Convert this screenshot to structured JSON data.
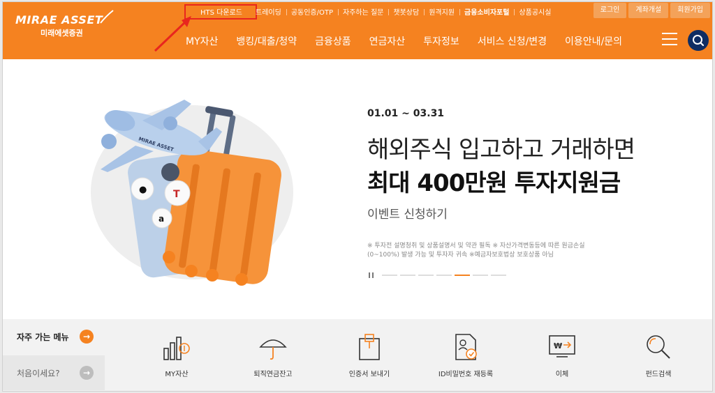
{
  "brand": {
    "name": "MIRAE ASSET",
    "name_kr": "미래에셋증권",
    "accent": "#f58220",
    "navy": "#0f2d63"
  },
  "util_nav": {
    "hts_label": "HTS 다운로드",
    "items": [
      "트레이딩",
      "공동인증/OTP",
      "자주하는 질문",
      "챗봇상담",
      "원격지원",
      "금융소비자포털",
      "상품공시실"
    ],
    "auth": [
      "로그인",
      "계좌개설",
      "회원가입"
    ]
  },
  "gnb": [
    "MY자산",
    "뱅킹/대출/청약",
    "금융상품",
    "연금자산",
    "투자정보",
    "서비스 신청/변경",
    "이용안내/문의"
  ],
  "hero": {
    "date": "01.01 ~ 03.31",
    "line1": "해외주식 입고하고 거래하면",
    "line2": "최대 400만원 투자지원금",
    "cta": "이벤트 신청하기",
    "note1": "※ 투자전 설명청취 및 상품설명서 및 약관 필독 ※ 자산가격변동등에 따른 원금손실",
    "note2": "(0~100%) 발생 가능 및 투자자 귀속 ※예금자보호법상 보호상품 아님",
    "slide_count": 7,
    "active_slide": 4
  },
  "quick_menu": {
    "side": {
      "frequent": "자주 가는 메뉴",
      "first": "처음이세요?"
    },
    "items": [
      {
        "label": "MY자산",
        "icon": "asset-chart-icon"
      },
      {
        "label": "퇴직연금잔고",
        "icon": "umbrella-icon"
      },
      {
        "label": "인증서 보내기",
        "icon": "certificate-box-icon"
      },
      {
        "label": "ID비밀번호 재등록",
        "icon": "id-document-icon"
      },
      {
        "label": "이체",
        "icon": "transfer-icon"
      },
      {
        "label": "펀드검색",
        "icon": "magnifier-icon"
      }
    ]
  }
}
